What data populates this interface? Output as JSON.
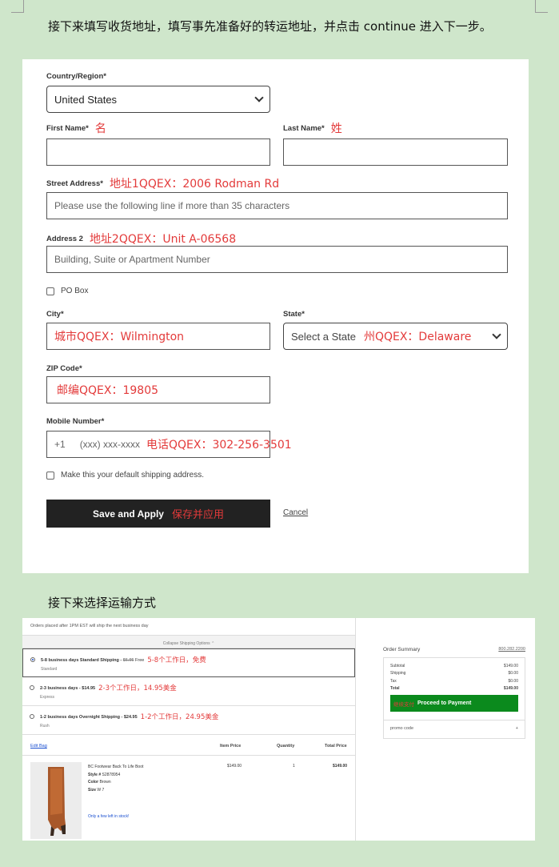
{
  "instructions": {
    "step1": "接下来填写收货地址，填写事先准备好的转运地址，并点击 continue 进入下一步。",
    "step2": "接下来选择运输方式"
  },
  "colors": {
    "background": "#cfe6cb",
    "annotation": "#e33a3a",
    "button_dark": "#222222",
    "proceed_green": "#0b8a1d"
  },
  "form": {
    "country_label": "Country/Region*",
    "country_value": "United States",
    "first_name_label": "First Name*",
    "first_name_note": "名",
    "last_name_label": "Last Name*",
    "last_name_note": "姓",
    "street_label": "Street Address*",
    "street_note": "地址1QQEX：2006 Rodman Rd",
    "street_placeholder": "Please use the following line if more than 35 characters",
    "address2_label": "Address 2",
    "address2_note": "地址2QQEX：Unit A-06568",
    "address2_placeholder": "Building, Suite or Apartment Number",
    "po_box_label": "PO Box",
    "city_label": "City*",
    "city_note": "城市QQEX：Wilmington",
    "state_label": "State*",
    "state_placeholder": "Select a State",
    "state_note": "州QQEX：Delaware",
    "zip_label": "ZIP Code*",
    "zip_note": "邮编QQEX：19805",
    "mobile_label": "Mobile Number*",
    "mobile_prefix": "+1",
    "mobile_placeholder": "(xxx) xxx-xxxx",
    "mobile_note": "电话QQEX：302-256-3501",
    "default_label": "Make this your default shipping address.",
    "save_label": "Save and Apply",
    "save_note": "保存并应用",
    "cancel_label": "Cancel"
  },
  "shipping": {
    "banner": "Orders placed after 1PM EST will ship the next business day",
    "collapse_label": "Collapse Shipping Options",
    "options": [
      {
        "title": "5-8 business days Standard Shipping -",
        "old_price": "$6.95",
        "price": "Free",
        "subtitle": "Standard",
        "note": "5-8个工作日，免费",
        "selected": true
      },
      {
        "title": "2-3 business days - $14.95",
        "old_price": "",
        "price": "",
        "subtitle": "Express",
        "note": "2-3个工作日，14.95美金",
        "selected": false
      },
      {
        "title": "1-2 business days Overnight Shipping - $24.95",
        "old_price": "",
        "price": "",
        "subtitle": "Rush",
        "note": "1-2个工作日，24.95美金",
        "selected": false
      }
    ],
    "table": {
      "edit_bag": "Edit Bag",
      "item_price": "Item Price",
      "quantity": "Quantity",
      "total_price": "Total Price"
    },
    "product": {
      "name": "BC Footwear Back To Life Boot",
      "style_label": "Style #",
      "style": "S2878954",
      "color_label": "Color",
      "color": "Brown",
      "size_label": "Size",
      "size": "W 7",
      "stock_note": "Only a few left in stock!",
      "price": "$149.00",
      "qty": "1",
      "total": "$149.00"
    },
    "summary": {
      "title": "Order Summary",
      "phone": "800.282.2200",
      "rows": [
        {
          "label": "Subtotal",
          "value": "$149.00"
        },
        {
          "label": "Shipping",
          "value": "$0.00"
        },
        {
          "label": "Tax",
          "value": "$0.00"
        },
        {
          "label": "Total",
          "value": "$149.00"
        }
      ],
      "proceed_note": "继续支付",
      "proceed_label": "Proceed to Payment",
      "promo_label": "promo code",
      "promo_plus": "+"
    }
  }
}
